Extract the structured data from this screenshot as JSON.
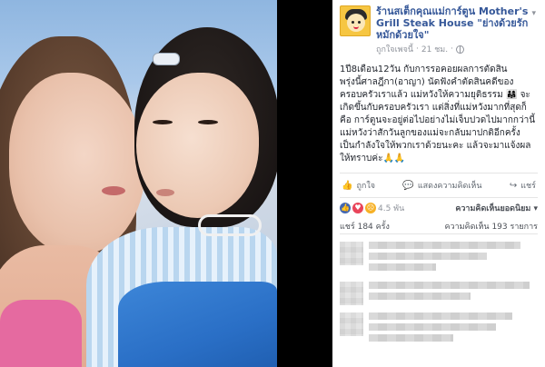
{
  "page": {
    "name": "ร้านสเต็กคุณแม่การ์ตูน Mother's Grill Steak House \"ย่างด้วยรัก หมักด้วยใจ\"",
    "author": "ถูกใจเพจนี้",
    "time": "21 ชม.",
    "privacy_icon": "globe-icon",
    "menu_icon": "chevron-down-icon"
  },
  "post": {
    "text": "1ปี8เดือน12วัน กับการรอคอยผลการตัดสิน\nพรุ่งนี้ศาลฎีกา(อาญา) นัดฟังคำตัดสินคดีของ\nครอบครัวเราแล้ว แม่หวังให้ความยุติธรรม 👨‍👩‍👧 จะ\nเกิดขึ้นกับครอบครัวเรา แต่สิ่งที่แม่หวังมากที่สุดก็\nคือ การ์ตูนจะอยู่ต่อไปอย่างไม่เจ็บปวดไปมากกว่านี้\nแม่หวังว่าสักวันลูกของแม่จะกลับมาปกติอีกครั้ง\nเป็นกำลังใจให้พวกเราด้วยนะคะ แล้วจะมาแจ้งผล\nให้ทราบค่ะ🙏🙏"
  },
  "actions": {
    "like": "ถูกใจ",
    "comment": "แสดงความคิดเห็น",
    "share": "แชร์"
  },
  "stats": {
    "reaction_count": "4.5 พัน",
    "top_comments": "ความคิดเห็นยอดนิยม",
    "shares": "แชร์ 184 ครั้ง",
    "comments": "ความคิดเห็น 193 รายการ"
  }
}
